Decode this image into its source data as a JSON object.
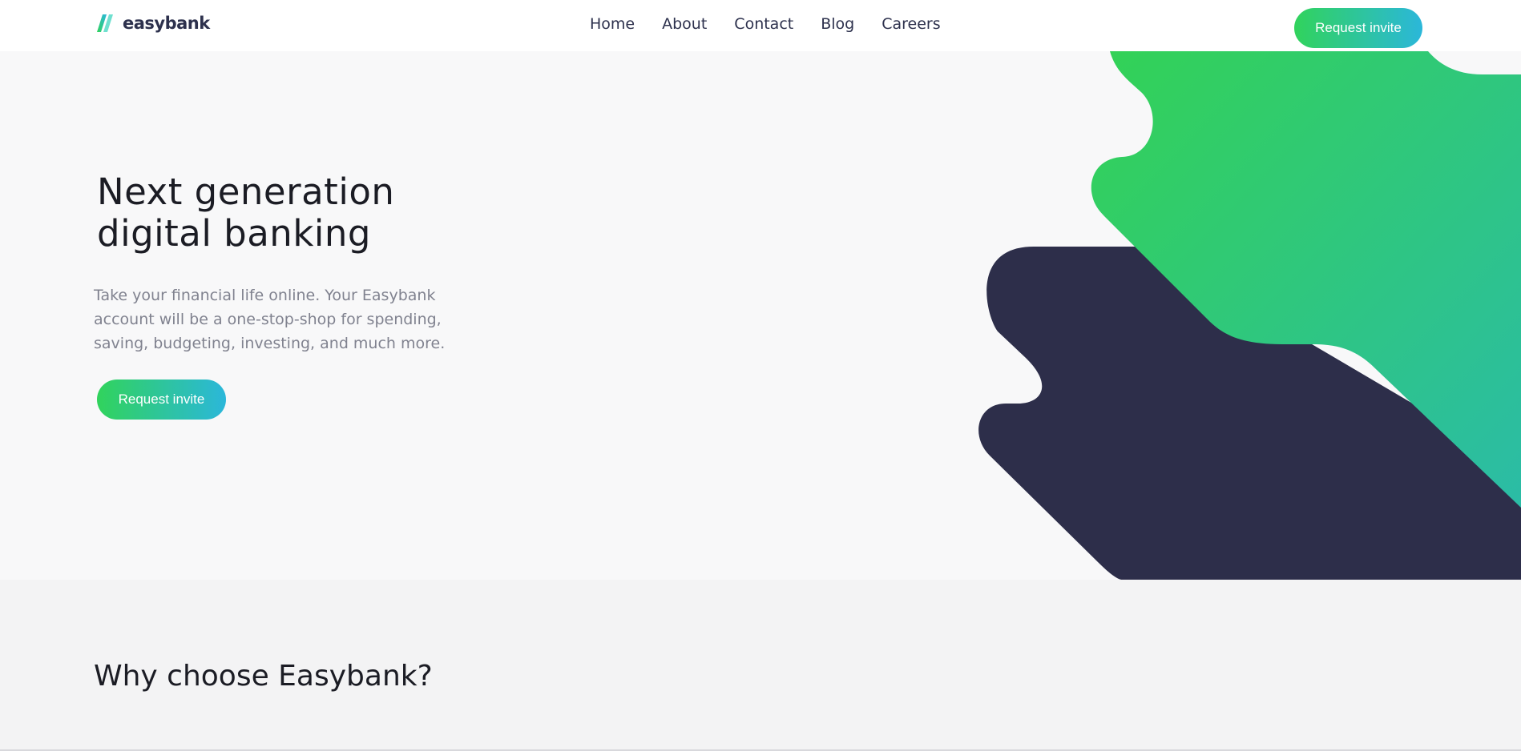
{
  "brand": {
    "name": "easybank",
    "logo_icon": "easybank-stripes-logo",
    "colors": {
      "green": "#31d35c",
      "cyan": "#2bb7da",
      "navy": "#2d314d",
      "hero_bg": "#f8f8f9"
    }
  },
  "nav": {
    "items": [
      {
        "label": "Home"
      },
      {
        "label": "About"
      },
      {
        "label": "Contact"
      },
      {
        "label": "Blog"
      },
      {
        "label": "Careers"
      }
    ]
  },
  "header": {
    "cta_label": "Request invite"
  },
  "hero": {
    "title_line1": "Next generation",
    "title_line2": "digital banking",
    "description": "Take your financial life online. Your Easybank account will be a one-stop-shop for spending, saving, budgeting, investing, and much more.",
    "cta_label": "Request invite"
  },
  "why": {
    "title": "Why choose Easybank?"
  }
}
